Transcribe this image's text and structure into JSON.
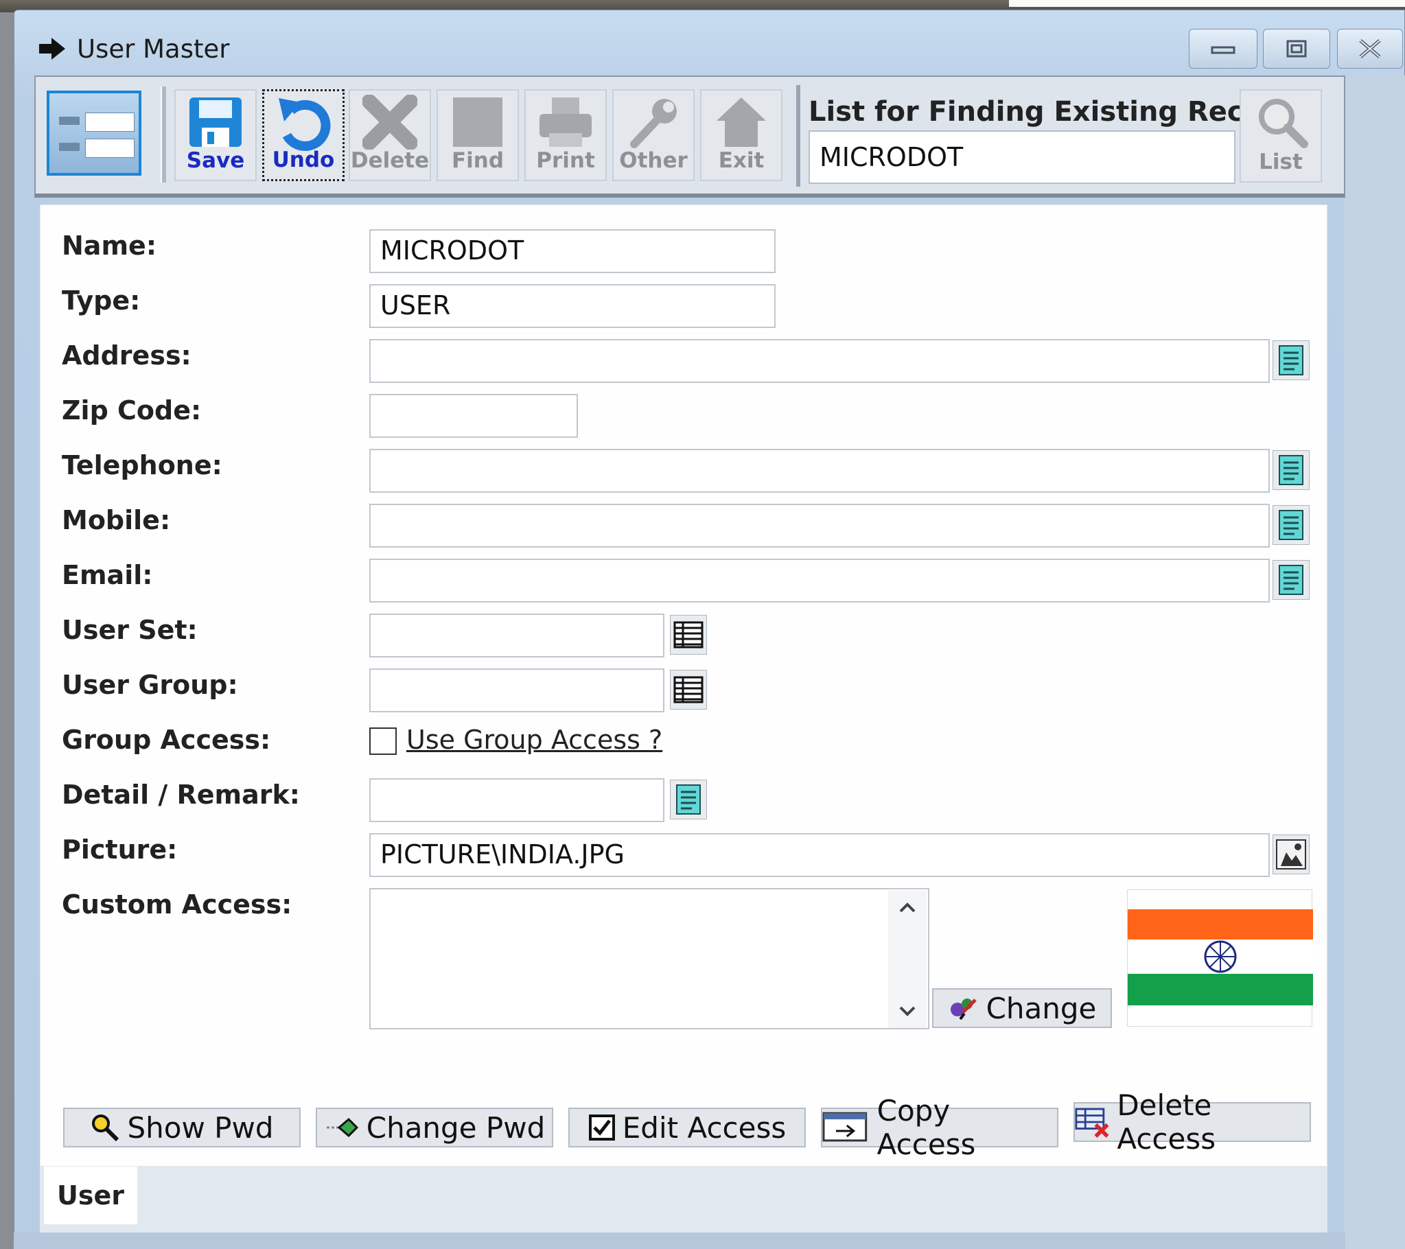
{
  "window": {
    "title": "User Master",
    "caption_buttons": [
      "minimize",
      "restore",
      "close"
    ]
  },
  "toolbar": {
    "buttons": [
      {
        "label": "Save",
        "enabled": true
      },
      {
        "label": "Undo",
        "enabled": true
      },
      {
        "label": "Delete",
        "enabled": false
      },
      {
        "label": "Find",
        "enabled": false
      },
      {
        "label": "Print",
        "enabled": false
      },
      {
        "label": "Other",
        "enabled": false
      },
      {
        "label": "Exit",
        "enabled": false
      }
    ],
    "find": {
      "label": "List for Finding Existing Record:",
      "value": "MICRODOT",
      "list_label": "List"
    }
  },
  "form": {
    "name": {
      "label": "Name:",
      "value": "MICRODOT"
    },
    "type": {
      "label": "Type:",
      "value": "USER"
    },
    "address": {
      "label": "Address:",
      "value": ""
    },
    "zip": {
      "label": "Zip Code:",
      "value": ""
    },
    "telephone": {
      "label": "Telephone:",
      "value": ""
    },
    "mobile": {
      "label": "Mobile:",
      "value": ""
    },
    "email": {
      "label": "Email:",
      "value": ""
    },
    "user_set": {
      "label": "User Set:",
      "value": ""
    },
    "user_group": {
      "label": "User Group:",
      "value": ""
    },
    "group_access": {
      "label": "Group Access:",
      "checkbox_label": "Use Group Access ?",
      "checked": false
    },
    "detail": {
      "label": "Detail / Remark:",
      "value": ""
    },
    "picture": {
      "label": "Picture:",
      "value": "PICTURE\\INDIA.JPG"
    },
    "custom_access": {
      "label": "Custom Access:",
      "value": ""
    },
    "change_button": "Change"
  },
  "bottom_buttons": {
    "show_pwd": "Show Pwd",
    "change_pwd": "Change Pwd",
    "edit_access": "Edit Access",
    "copy_access": "Copy Access",
    "delete_access": "Delete Access"
  },
  "tabs": [
    {
      "label": "User",
      "active": true
    }
  ],
  "colors": {
    "title_bar": "#c8dcf0",
    "accent": "#1a2bc2",
    "flag_saffron": "#ff6418",
    "flag_green": "#14a04a"
  }
}
